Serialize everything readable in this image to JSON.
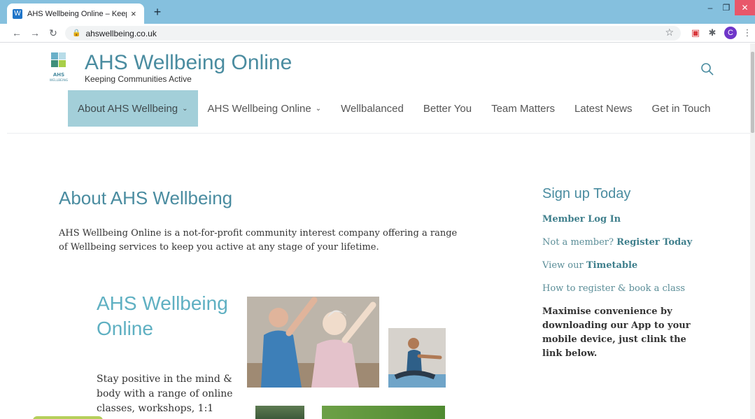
{
  "browser": {
    "tab_title": "AHS Wellbeing Online – Keeping Communities Active",
    "tab_close": "×",
    "new_tab": "+",
    "url": "ahswellbeing.co.uk",
    "avatar_letter": "C",
    "icons": [
      "back-arrow-icon",
      "forward-arrow-icon",
      "reload-icon",
      "lock-icon",
      "star-icon",
      "extension-icon",
      "puzzle-icon",
      "menu-dots-icon"
    ]
  },
  "site": {
    "title": "AHS Wellbeing Online",
    "tagline": "Keeping Communities Active",
    "logo_text": "AHS",
    "logo_subtext": "WELLBEING"
  },
  "nav": {
    "items": [
      {
        "label": "About AHS Wellbeing",
        "dropdown": true,
        "active": true
      },
      {
        "label": "AHS Wellbeing Online",
        "dropdown": true,
        "active": false
      },
      {
        "label": "Wellbalanced",
        "dropdown": false,
        "active": false
      },
      {
        "label": "Better You",
        "dropdown": false,
        "active": false
      },
      {
        "label": "Team Matters",
        "dropdown": false,
        "active": false
      },
      {
        "label": "Latest News",
        "dropdown": false,
        "active": false
      },
      {
        "label": "Get in Touch",
        "dropdown": false,
        "active": false
      }
    ]
  },
  "main": {
    "heading": "About AHS Wellbeing",
    "intro": "AHS Wellbeing Online is a not-for-profit community interest company offering a range of Wellbeing services to keep you active at any stage of your lifetime.",
    "feature_title": "AHS Wellbeing Online",
    "feature_text": "Stay positive in the mind & body with a range of online classes, workshops, 1:1"
  },
  "sidebar": {
    "heading": "Sign up Today",
    "member_login": "Member Log In",
    "not_member_prefix": "Not a member?",
    "register_link": "Register Today",
    "view_prefix": "View our",
    "timetable_link": "Timetable",
    "howto_link": "How to register & book a class",
    "note": "Maximise convenience by downloading our App to your mobile device, just clink the link below."
  },
  "colors": {
    "tabbar": "#85c0de",
    "brand_teal": "#4a8ca0",
    "nav_active": "#a3cfd9",
    "close_red": "#e8576a",
    "avatar_purple": "#6f36c9"
  }
}
